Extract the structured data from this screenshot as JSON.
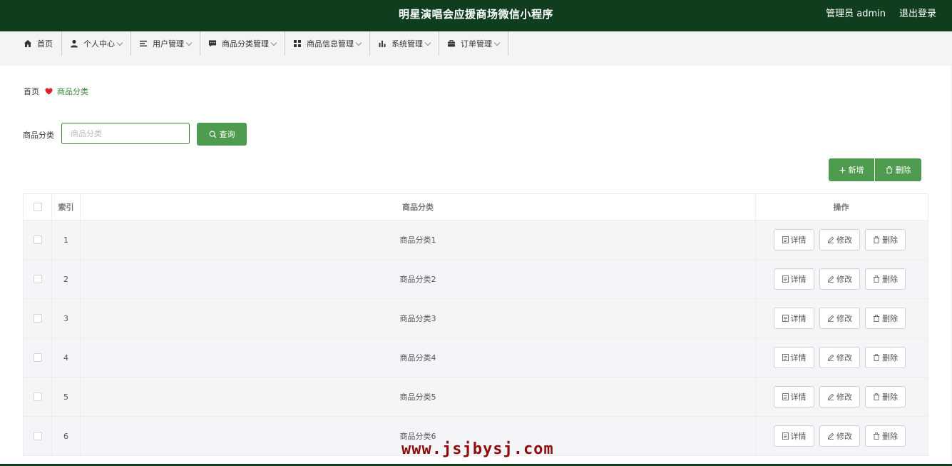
{
  "header": {
    "title": "明星演唱会应援商场微信小程序",
    "user": "管理员 admin",
    "logout": "退出登录"
  },
  "nav": [
    {
      "label": "首页",
      "icon": "home-icon",
      "has_dropdown": false
    },
    {
      "label": "个人中心",
      "icon": "user-icon",
      "has_dropdown": true
    },
    {
      "label": "用户管理",
      "icon": "list-icon",
      "has_dropdown": true
    },
    {
      "label": "商品分类管理",
      "icon": "chat-icon",
      "has_dropdown": true
    },
    {
      "label": "商品信息管理",
      "icon": "grid-icon",
      "has_dropdown": true
    },
    {
      "label": "系统管理",
      "icon": "bar-chart-icon",
      "has_dropdown": true
    },
    {
      "label": "订单管理",
      "icon": "briefcase-icon",
      "has_dropdown": true
    }
  ],
  "breadcrumb": {
    "home": "首页",
    "current": "商品分类"
  },
  "search": {
    "label": "商品分类",
    "placeholder": "商品分类",
    "button": "查询"
  },
  "actions": {
    "add": "新增",
    "delete": "删除"
  },
  "table": {
    "headers": {
      "index": "索引",
      "name": "商品分类",
      "ops": "操作"
    },
    "rows": [
      {
        "index": "1",
        "name": "商品分类1"
      },
      {
        "index": "2",
        "name": "商品分类2"
      },
      {
        "index": "3",
        "name": "商品分类3"
      },
      {
        "index": "4",
        "name": "商品分类4"
      },
      {
        "index": "5",
        "name": "商品分类5"
      },
      {
        "index": "6",
        "name": "商品分类6"
      }
    ],
    "row_buttons": {
      "detail": "详情",
      "edit": "修改",
      "delete": "删除"
    }
  },
  "watermark": "www.jsjbysj.com",
  "colors": {
    "header_bg": "#0f3d1e",
    "accent_green": "#4e9a4e",
    "breadcrumb_current": "#3a8a3a",
    "heart": "#d8232a",
    "watermark": "#8b0d0d"
  }
}
